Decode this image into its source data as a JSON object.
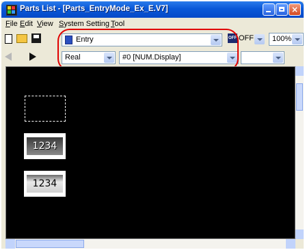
{
  "window": {
    "title": "Parts List - [Parts_EntryMode_Ex_E.V7]"
  },
  "menu": {
    "items": [
      {
        "key": "F",
        "rest": "ile"
      },
      {
        "key": "E",
        "rest": "dit"
      },
      {
        "key": "V",
        "rest": "iew"
      },
      {
        "key": "S",
        "rest": "ystem Setting"
      },
      {
        "key": "T",
        "rest": "ool"
      }
    ]
  },
  "toolbar": {
    "mode_combo": "Entry",
    "off_icon_text": "OFF",
    "off_label": "OFF",
    "zoom_combo": "100%",
    "type_combo": "Real",
    "part_combo": "#0 [NUM.Display]"
  },
  "canvas": {
    "numeric_display_1": "1234",
    "numeric_display_2": "1234"
  },
  "colors": {
    "highlight": "#e00000",
    "canvas": "#000000",
    "titlebar": "#0a58d8"
  }
}
